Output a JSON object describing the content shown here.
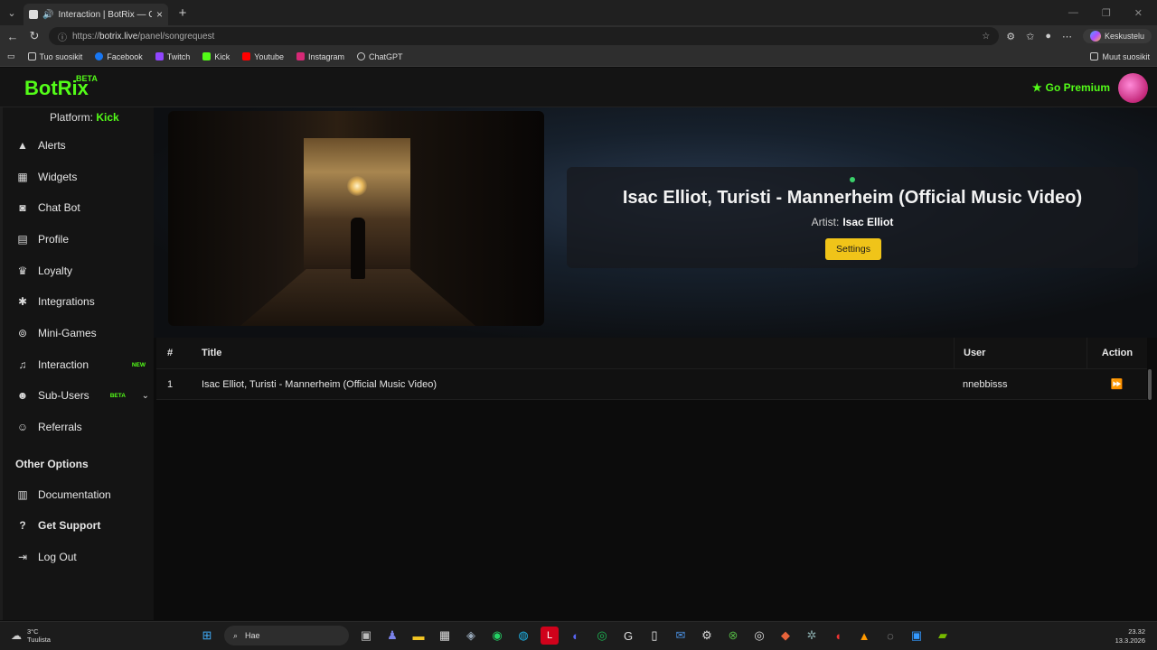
{
  "browser": {
    "tab_title": "Interaction | BotRix — Cloud",
    "url_scheme": "https://",
    "url_host": "botrix.live",
    "url_path": "/panel/songrequest",
    "profile_label": "Keskustelu",
    "bookmarks": [
      "Tuo suosikit",
      "Facebook",
      "Twitch",
      "Kick",
      "Youtube",
      "Instagram",
      "ChatGPT"
    ],
    "other_bookmarks": "Muut suosikit"
  },
  "app": {
    "logo": "BotRix",
    "logo_badge": "BETA",
    "premium_label": "Go Premium",
    "platform_label": "Platform:",
    "platform_value": "Kick",
    "nav": [
      {
        "label": "Alerts",
        "icon": "warning-icon"
      },
      {
        "label": "Widgets",
        "icon": "grid-icon"
      },
      {
        "label": "Chat Bot",
        "icon": "robot-icon"
      },
      {
        "label": "Profile",
        "icon": "id-card-icon"
      },
      {
        "label": "Loyalty",
        "icon": "trophy-icon"
      },
      {
        "label": "Integrations",
        "icon": "puzzle-icon"
      },
      {
        "label": "Mini-Games",
        "icon": "gamepad-icon"
      },
      {
        "label": "Interaction",
        "icon": "music-icon",
        "badge": "NEW"
      },
      {
        "label": "Sub-Users",
        "icon": "users-icon",
        "badge": "BETA"
      },
      {
        "label": "Referrals",
        "icon": "user-plus-icon"
      }
    ],
    "other_options": "Other Options",
    "other_nav": [
      {
        "label": "Documentation",
        "icon": "book-icon"
      },
      {
        "label": "Get Support",
        "icon": "question-icon"
      },
      {
        "label": "Log Out",
        "icon": "logout-icon"
      }
    ]
  },
  "now_playing": {
    "title": "Isac Elliot, Turisti - Mannerheim (Official Music Video)",
    "artist_label": "Artist:",
    "artist": "Isac Elliot",
    "settings_label": "Settings"
  },
  "queue": {
    "columns": [
      "#",
      "Title",
      "User",
      "Action"
    ],
    "rows": [
      {
        "num": "1",
        "title": "Isac Elliot, Turisti - Mannerheim (Official Music Video)",
        "user": "nnebbisss"
      }
    ]
  },
  "taskbar": {
    "temp": "3°C",
    "weather": "Tuulista",
    "search_placeholder": "Hae",
    "time": "23.32",
    "date": "13.3.2026"
  }
}
